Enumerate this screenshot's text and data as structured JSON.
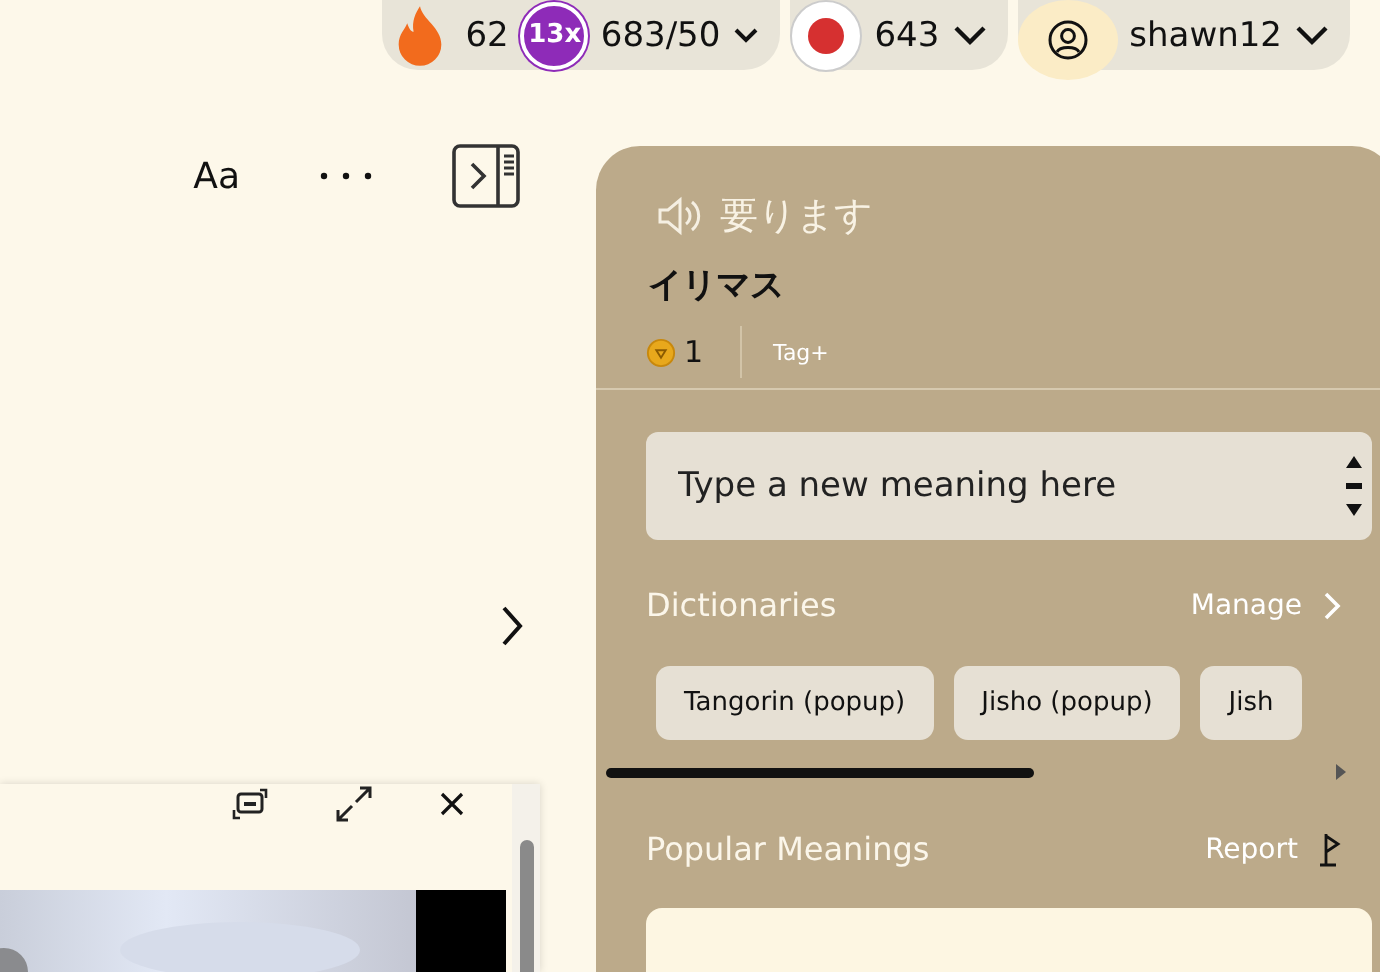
{
  "top_bar": {
    "streak": "62",
    "multiplier": "13x",
    "progress": "683/50",
    "points": "643",
    "user": "shawn12"
  },
  "toolbar": {
    "font_button": "Aa"
  },
  "panel": {
    "word": "要ります",
    "reading": "イリマス",
    "coins": "1",
    "tag_button": "Tag+",
    "meaning_field": {
      "placeholder": "Type a new meaning here"
    },
    "dictionaries": {
      "title": "Dictionaries",
      "manage": "Manage",
      "items": [
        "Tangorin (popup)",
        "Jisho (popup)",
        "Jish"
      ]
    },
    "popular_meanings": {
      "title": "Popular Meanings",
      "report": "Report"
    }
  }
}
